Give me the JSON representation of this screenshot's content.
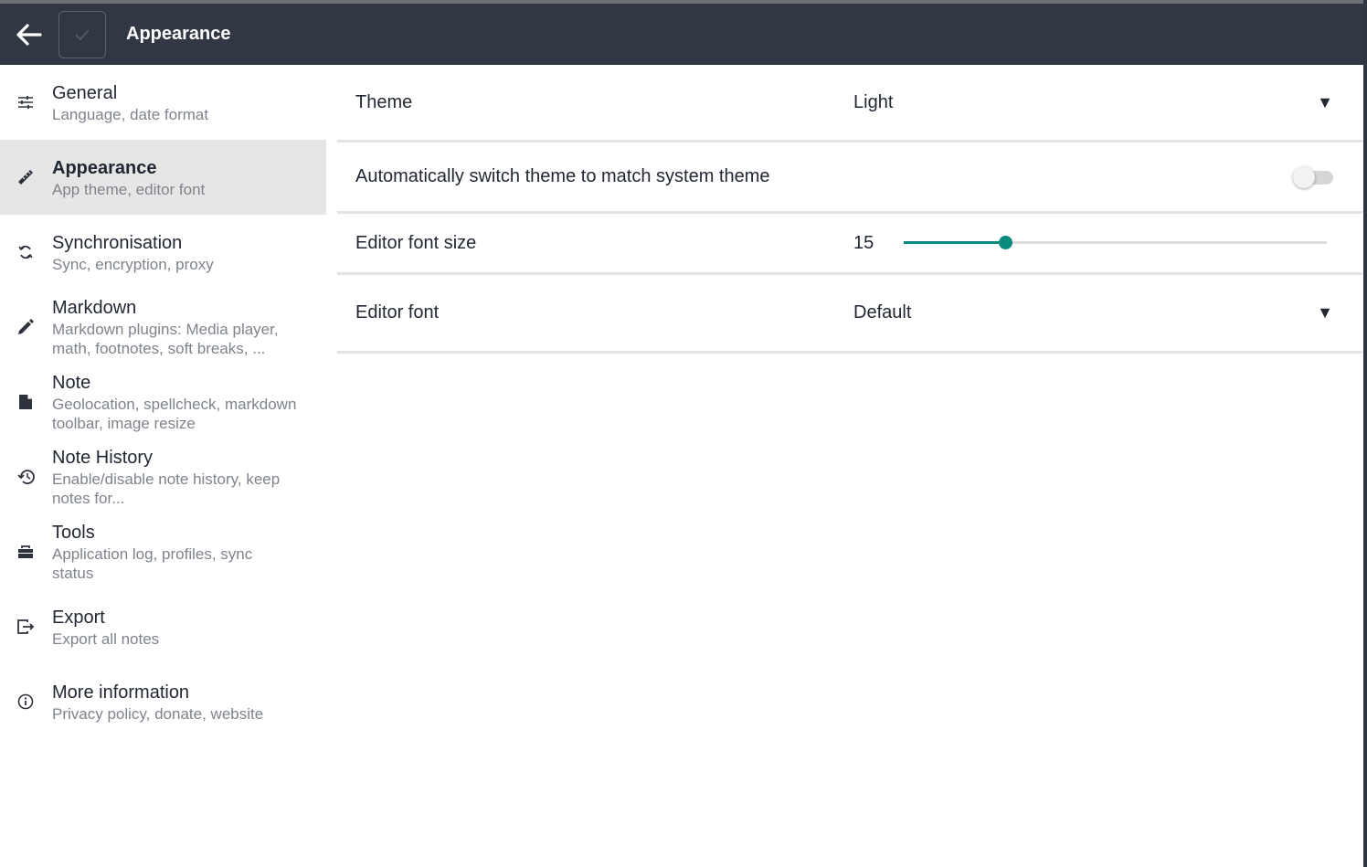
{
  "header": {
    "title": "Appearance",
    "back_icon": "arrow-left-icon",
    "check_icon": "checkmark-icon"
  },
  "sidebar": {
    "items": [
      {
        "title": "General",
        "desc": "Language, date format",
        "icon": "sliders-icon"
      },
      {
        "title": "Appearance",
        "desc": "App theme, editor font",
        "icon": "ruler-icon",
        "active": true
      },
      {
        "title": "Synchronisation",
        "desc": "Sync, encryption, proxy",
        "icon": "sync-icon"
      },
      {
        "title": "Markdown",
        "desc": "Markdown plugins: Media player, math, footnotes, soft breaks, ...",
        "icon": "pencil-icon"
      },
      {
        "title": "Note",
        "desc": "Geolocation, spellcheck, markdown toolbar, image resize",
        "icon": "file-icon"
      },
      {
        "title": "Note History",
        "desc": "Enable/disable note history, keep notes for...",
        "icon": "history-icon"
      },
      {
        "title": "Tools",
        "desc": "Application log, profiles, sync status",
        "icon": "toolbox-icon"
      },
      {
        "title": "Export",
        "desc": "Export all notes",
        "icon": "export-icon"
      },
      {
        "title": "More information",
        "desc": "Privacy policy, donate, website",
        "icon": "info-icon"
      }
    ]
  },
  "settings": {
    "theme": {
      "label": "Theme",
      "value": "Light"
    },
    "auto_switch": {
      "label": "Automatically switch theme to match system theme",
      "enabled": false
    },
    "font_size": {
      "label": "Editor font size",
      "value": "15",
      "slider_fraction": 0.24
    },
    "editor_font": {
      "label": "Editor font",
      "value": "Default"
    }
  },
  "colors": {
    "header_bg": "#323744",
    "accent": "#088a7c",
    "active_item_bg": "#e6e6e6"
  }
}
